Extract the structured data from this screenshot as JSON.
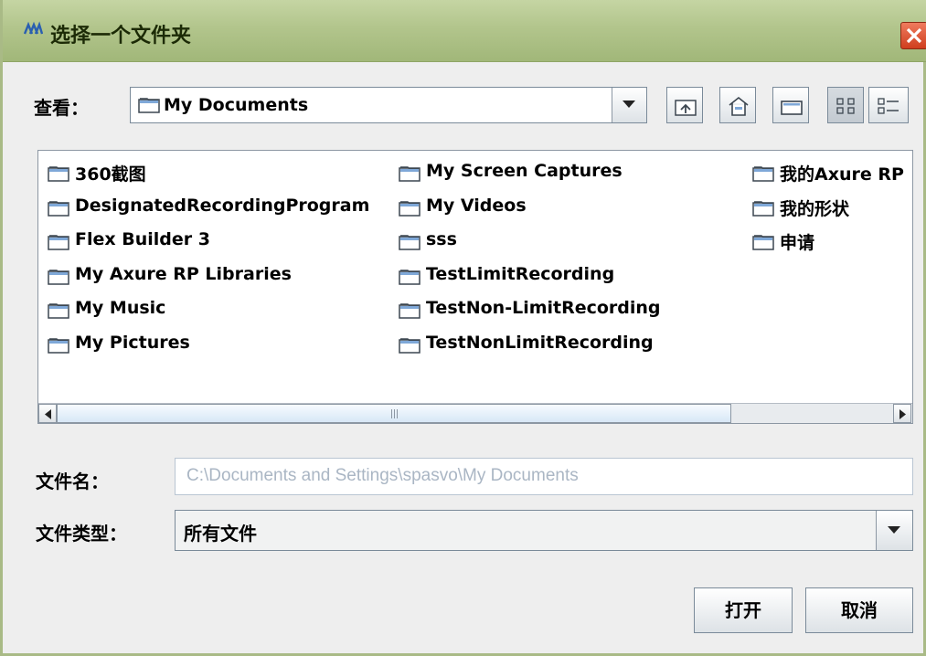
{
  "window": {
    "title": "选择一个文件夹",
    "icon": "java-cup-icon",
    "close": "close-icon"
  },
  "toolbar": {
    "lookin_label": "查看：",
    "lookin_value": "My Documents",
    "buttons": [
      "up-one-level-icon",
      "home-icon",
      "new-folder-icon",
      "list-view-icon",
      "details-view-icon"
    ]
  },
  "files": {
    "columns": [
      [
        "360截图",
        "DesignatedRecordingProgram",
        "Flex Builder 3",
        "My Axure RP Libraries",
        "My Music",
        "My Pictures"
      ],
      [
        "My Screen Captures",
        "My Videos",
        "sss",
        "TestLimitRecording",
        "TestNon-LimitRecording",
        "TestNonLimitRecording"
      ],
      [
        "我的Axure RP",
        "我的形状",
        "申请"
      ]
    ]
  },
  "filename": {
    "label": "文件名：",
    "value": "C:\\Documents and Settings\\spasvo\\My Documents"
  },
  "filetype": {
    "label": "文件类型：",
    "value": "所有文件"
  },
  "actions": {
    "open": "打开",
    "cancel": "取消"
  },
  "colors": {
    "titlebar": "#b2c58c",
    "close": "#cf3e1e",
    "scroll_thumb": "#d7e7f6"
  }
}
